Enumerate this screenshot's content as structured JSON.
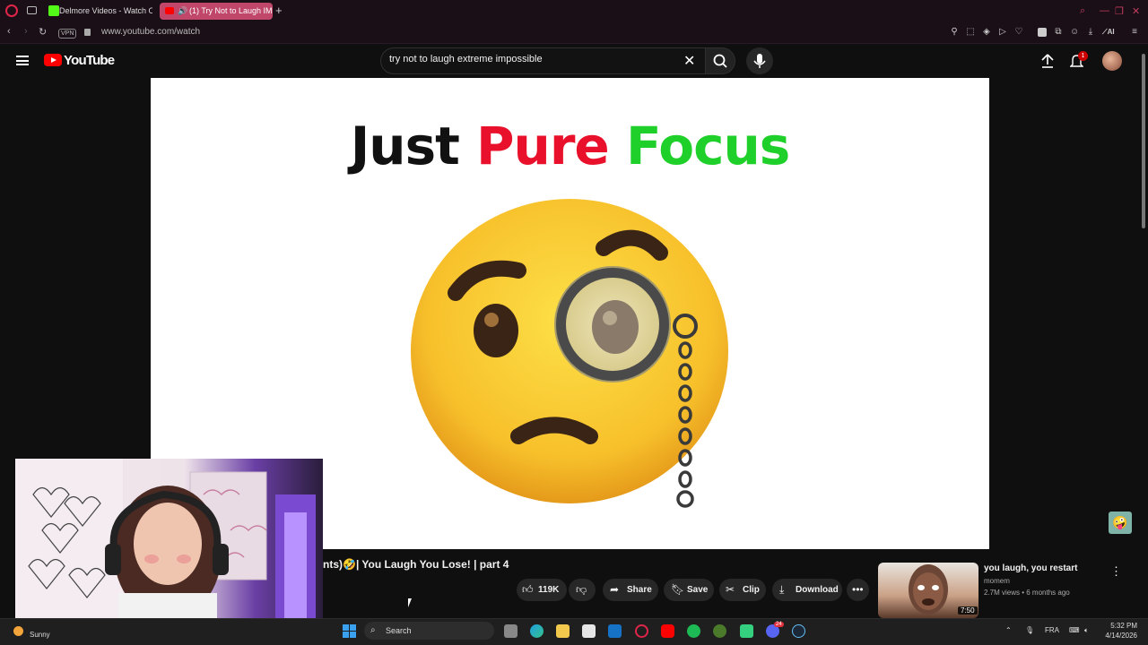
{
  "browser": {
    "tabs": [
      {
        "label": "Delmore Videos - Watch O",
        "active": false
      },
      {
        "label": "(1) Try Not to Laugh IM",
        "active": true
      }
    ],
    "url": "www.youtube.com/watch",
    "vpn_label": "VPN",
    "ai_label": "AI"
  },
  "youtube": {
    "logo_text": "YouTube",
    "search_value": "try not to laugh extreme impossible",
    "notification_count": "1"
  },
  "video": {
    "overlay_words": [
      "Just",
      "Pure",
      "Focus"
    ],
    "overlay_colors": [
      "#111111",
      "#e8102a",
      "#1fcf2a"
    ],
    "title": "nts)🤣| You Laugh You Lose! | part 4",
    "like_count": "119K",
    "actions": {
      "share": "Share",
      "save": "Save",
      "clip": "Clip",
      "download": "Download"
    }
  },
  "recommended": {
    "title": "you laugh, you restart",
    "channel": "momem",
    "meta": "2.7M views • 6 months ago",
    "duration": "7:50"
  },
  "taskbar": {
    "weather": "Sunny",
    "search_label": "Search",
    "lang": "FRA",
    "time": "5:32 PM",
    "date": "4/14/2026",
    "discord_badge": "24"
  }
}
